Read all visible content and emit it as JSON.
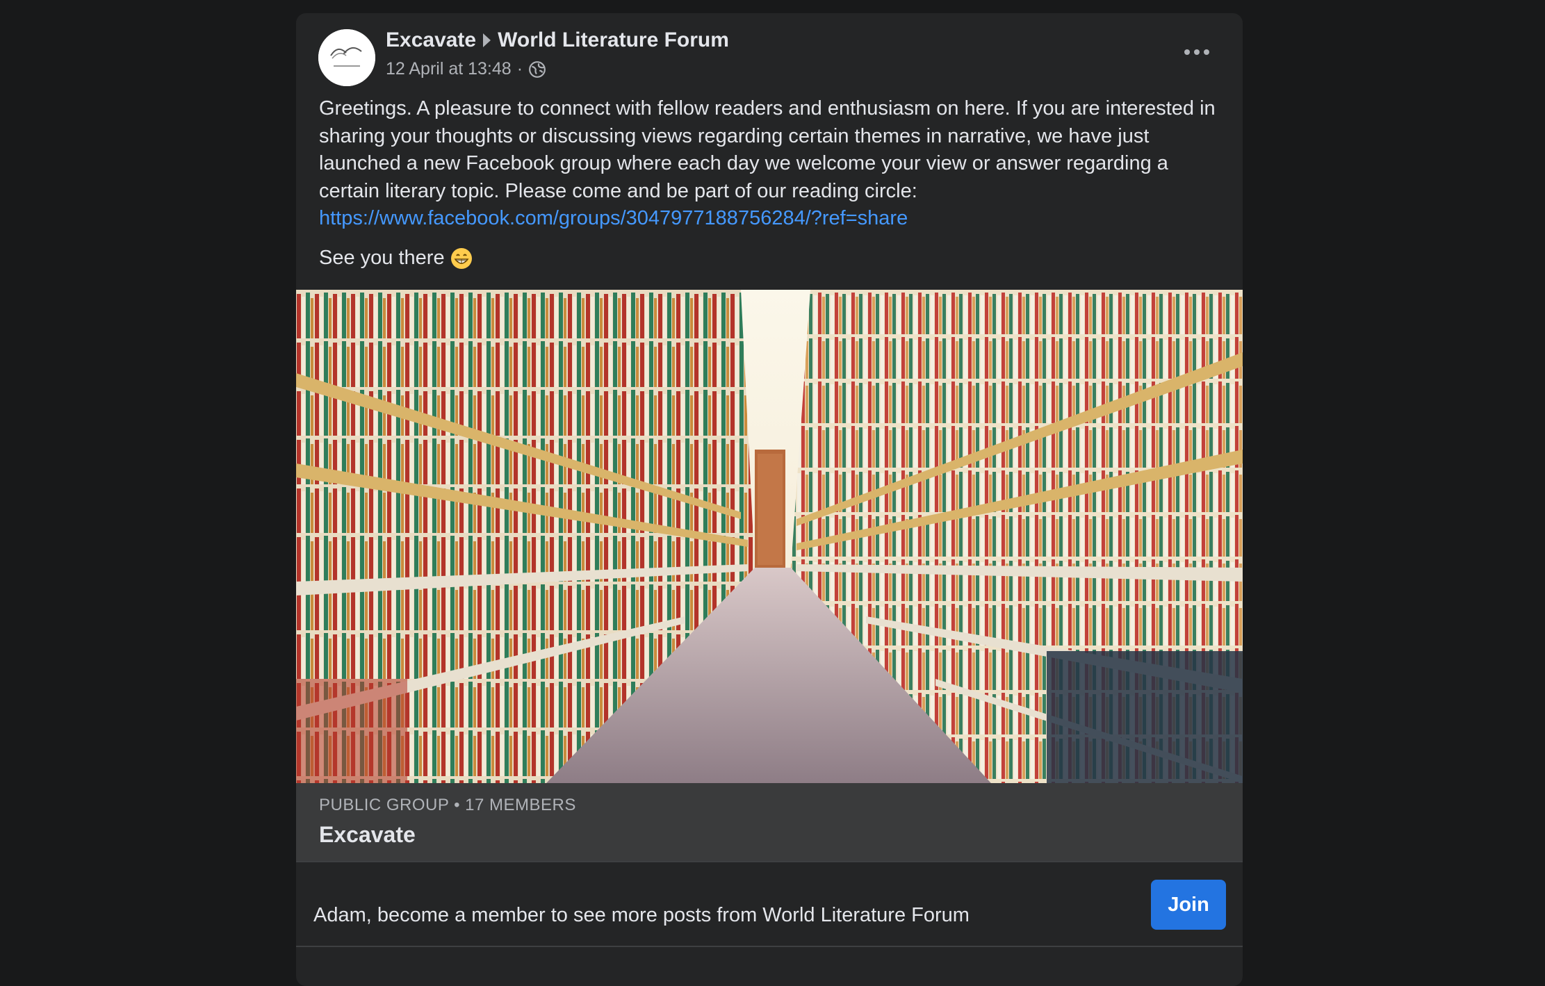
{
  "post": {
    "group_name": "Excavate",
    "forum_name": "World Literature Forum",
    "timestamp": "12 April at 13:48",
    "separator": "·",
    "body": "Greetings. A pleasure to connect with fellow readers and enthusiasm on here. If you are interested in sharing your thoughts or discussing views regarding certain themes in narrative, we have just launched a new Facebook group where each day we welcome your view or answer regarding a certain literary topic. Please come and be part of our reading circle:",
    "link": "https://www.facebook.com/groups/3047977188756284/?ref=share",
    "closing": "See you there",
    "closing_emoji": "grinning-face-emoji"
  },
  "link_card": {
    "meta": "PUBLIC GROUP • 17 MEMBERS",
    "title": "Excavate"
  },
  "cta": {
    "text": "Adam, become a member to see more posts from World Literature Forum",
    "join_label": "Join"
  },
  "icons": {
    "privacy": "globe-icon",
    "menu": "more-options-icon"
  },
  "colors": {
    "accent": "#2374e1",
    "link": "#4599ff",
    "card_bg": "#242526",
    "page_bg": "#18191a"
  }
}
